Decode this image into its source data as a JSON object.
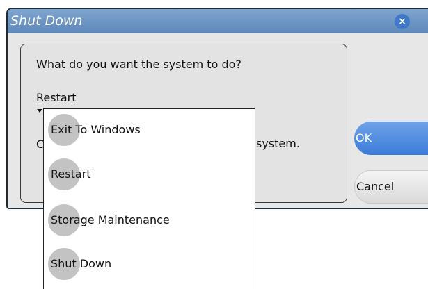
{
  "dialog": {
    "title": "Shut Down",
    "close_icon": "close-icon",
    "close_glyph": "×"
  },
  "panel": {
    "question": "What do you want the system to do?",
    "selected_option": "Restart",
    "info_start": "C",
    "info_end": "system."
  },
  "dropdown": {
    "options": [
      {
        "label": "Exit To Windows"
      },
      {
        "label": "Restart"
      },
      {
        "label": "Storage Maintenance"
      },
      {
        "label": "Shut Down"
      }
    ]
  },
  "buttons": {
    "ok_label": "OK",
    "cancel_label": "Cancel"
  },
  "colors": {
    "titlebar": "#6f97c6",
    "ok_button": "#4a87de",
    "close_button": "#3f77c9",
    "menu_circle": "#c3c3c3"
  }
}
